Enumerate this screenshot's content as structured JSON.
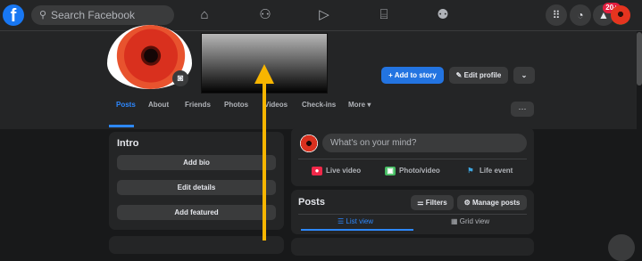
{
  "topbar": {
    "search_placeholder": "Search Facebook",
    "logo_letter": "f",
    "nav_icons": [
      "home-icon",
      "friends-icon",
      "watch-icon",
      "marketplace-icon",
      "groups-icon"
    ],
    "right_icons": [
      "menu-grid-icon",
      "messenger-icon",
      "notifications-icon"
    ],
    "notification_count": "20+"
  },
  "profile": {
    "add_story_label": "+ Add to story",
    "edit_profile_label": "✎ Edit profile",
    "dropdown_label": "⌄"
  },
  "tabs": {
    "items": [
      "Posts",
      "About",
      "Friends",
      "Photos",
      "Videos",
      "Check-ins",
      "More ▾"
    ],
    "more_label": "···"
  },
  "intro": {
    "title": "Intro",
    "buttons": [
      "Add bio",
      "Edit details",
      "Add featured"
    ]
  },
  "composer": {
    "placeholder": "What's on your mind?",
    "actions": [
      "Live video",
      "Photo/video",
      "Life event"
    ]
  },
  "posts": {
    "title": "Posts",
    "filters_label": "⚌ Filters",
    "manage_label": "⚙ Manage posts",
    "views": [
      "☰ List view",
      "▦ Grid view"
    ]
  },
  "colors": {
    "accent": "#2d88ff",
    "brand": "#1877f2",
    "annotation_arrow": "#f7b500"
  }
}
